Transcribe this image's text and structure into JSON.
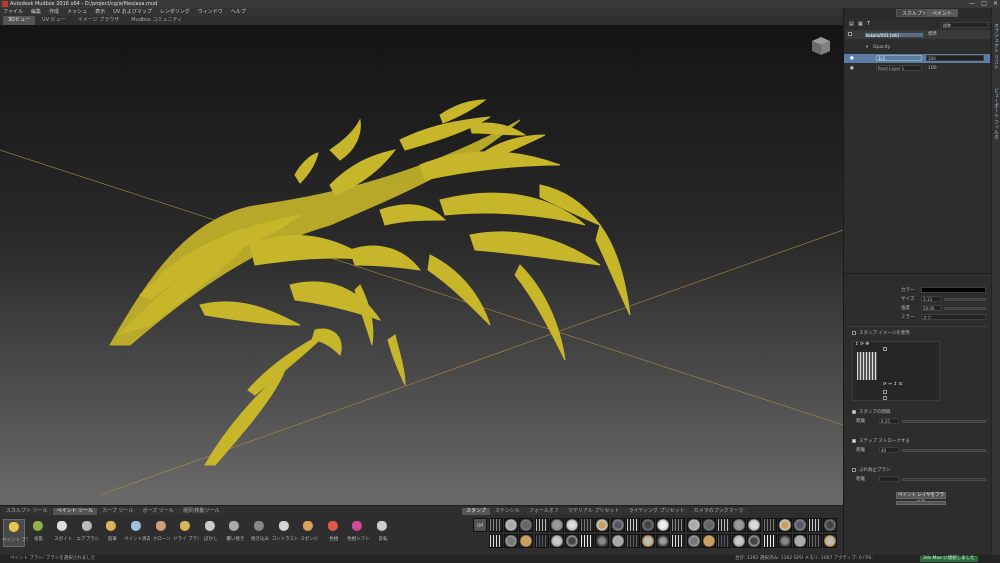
{
  "window": {
    "title": "Autodesk Mudbox 2016 x64 - D:/project/cg/a/files/axa.mud",
    "controls": [
      "—",
      "□",
      "✕"
    ]
  },
  "menu": [
    "ファイル",
    "編集",
    "作成",
    "メッシュ",
    "表示",
    "UV およびマップ",
    "レンダリング",
    "ウィンドウ",
    "ヘルプ"
  ],
  "view_tabs": [
    {
      "label": "3Dビュー",
      "active": true
    },
    {
      "label": "UV ビュー",
      "active": false
    },
    {
      "label": "イメージ ブラウザ",
      "active": false
    },
    {
      "label": "Mudbox コミュニティ",
      "active": false
    }
  ],
  "right_panel": {
    "tabs": [
      "スカルプト",
      "ペイント"
    ],
    "mode_select": "標準",
    "layer_header": {
      "name": "kokoro/XX1 [stk]",
      "mode": "標準"
    },
    "channel": "Opacity",
    "layers": [
      {
        "name": "1c1",
        "value": "100",
        "selected": true
      },
      {
        "name": "Paint Layer 1",
        "value": "100",
        "selected": false
      }
    ],
    "vertical_tabs": [
      "オブジェクト リスト",
      "ビューポート フィルタ"
    ],
    "props": {
      "color_label": "カラー",
      "size_label": "サイズ",
      "size_value": "3.13",
      "strength_label": "強度",
      "strength_value": "20.00",
      "mirror_label": "ミラー",
      "mirror_value": "オフ",
      "stamp_image_label": "スタンプ イメージを使用",
      "randomize_label": "スタンプの間隔",
      "randomize_field_label": "距離",
      "randomize_value": "6.25",
      "stamp_spacing_label": "ステップ ストロークする",
      "stamp_spacing_field_label": "距離",
      "stamp_spacing_value": "40",
      "steady_label": "ぶれ防止ブラシ",
      "steady_field_label": "距離",
      "reset_button": "ペイント レイヤをフラット"
    },
    "stamp_options": [
      "ランダム化",
      "回転",
      "向き",
      "反転",
      "左右反転",
      "上下反転"
    ]
  },
  "shelf": {
    "tabs": [
      {
        "label": "スカルプト ツール",
        "active": false
      },
      {
        "label": "ペイント ツール",
        "active": true
      },
      {
        "label": "カーブ ツール",
        "active": false
      },
      {
        "label": "ポーズ ツール",
        "active": false
      },
      {
        "label": "選択/移動ツール",
        "active": false
      }
    ],
    "tools": [
      {
        "label": "ペイント ブラシ",
        "icon": "paint-brush-icon",
        "active": true
      },
      {
        "label": "投影",
        "icon": "projection-icon",
        "active": false
      },
      {
        "label": "スポイト",
        "icon": "eyedropper-icon",
        "active": false
      },
      {
        "label": "エアブラシ",
        "icon": "airbrush-icon",
        "active": false
      },
      {
        "label": "鉛筆",
        "icon": "pencil-icon",
        "active": false
      },
      {
        "label": "ペイント消去",
        "icon": "eraser-icon",
        "active": false
      },
      {
        "label": "クローン",
        "icon": "clone-icon",
        "active": false
      },
      {
        "label": "ドライ ブラシ",
        "icon": "dry-brush-icon",
        "active": false
      },
      {
        "label": "ぼかし",
        "icon": "blur-icon",
        "active": false
      },
      {
        "label": "覆い焼き",
        "icon": "dodge-icon",
        "active": false
      },
      {
        "label": "焼き込み",
        "icon": "burn-icon",
        "active": false
      },
      {
        "label": "コントラスト",
        "icon": "contrast-icon",
        "active": false
      },
      {
        "label": "スポンジ",
        "icon": "sponge-icon",
        "active": false
      },
      {
        "label": "色相",
        "icon": "hue-icon",
        "active": false
      },
      {
        "label": "色相シフト",
        "icon": "hue-shift-icon",
        "active": false
      },
      {
        "label": "反転",
        "icon": "invert-icon",
        "active": false
      }
    ],
    "stamp_tabs": [
      {
        "label": "スタンプ",
        "active": true
      },
      {
        "label": "ステンシル",
        "active": false
      },
      {
        "label": "フォールオフ",
        "active": false
      },
      {
        "label": "マテリアル プリセット",
        "active": false
      },
      {
        "label": "ライティング プリセット",
        "active": false
      },
      {
        "label": "カメラのブックマーク",
        "active": false
      }
    ],
    "off_label": "Off"
  },
  "status": {
    "left": "ペイント ブラシ: ブラシを選択されました",
    "right": "合計: 1392    選択済み: 1392  GPU メモリ: 1667  アクティブ: 0    FPS:",
    "badge": "3ds Max に接続しました"
  },
  "colors": {
    "paint": "#c8b62a",
    "accent": "#4f6f93",
    "badge": "#2e6b3a"
  }
}
